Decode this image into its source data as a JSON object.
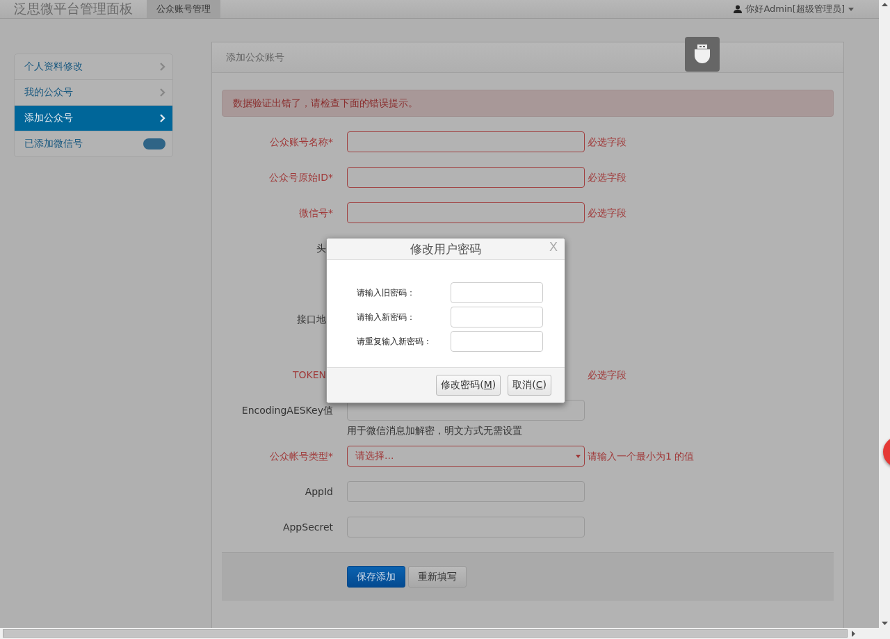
{
  "navbar": {
    "brand": "泛思微平台管理面板",
    "tabs": [
      {
        "label": "公众账号管理",
        "selected": true
      }
    ],
    "user": "你好Admin[超级管理员]"
  },
  "sidebar": {
    "items": [
      {
        "label": "个人资料修改",
        "selected": false,
        "kind": "link"
      },
      {
        "label": "我的公众号",
        "selected": false,
        "kind": "link"
      },
      {
        "label": "添加公众号",
        "selected": true,
        "kind": "link"
      },
      {
        "label": "已添加微信号",
        "selected": false,
        "kind": "badge"
      }
    ]
  },
  "panel": {
    "title": "添加公众账号",
    "alert": "数据验证出错了，请检查下面的错误提示。",
    "fields": [
      {
        "kind": "input",
        "label": "公众账号名称",
        "required_mark": "*",
        "invalid": true,
        "error": "必选字段"
      },
      {
        "kind": "input",
        "label": "公众号原始ID",
        "required_mark": "*",
        "invalid": true,
        "error": "必选字段"
      },
      {
        "kind": "input",
        "label": "微信号",
        "required_mark": "*",
        "invalid": true,
        "error": "必选字段"
      },
      {
        "kind": "covered",
        "label": "头",
        "invalid": false
      },
      {
        "kind": "covered",
        "label": "接口地",
        "invalid": false
      },
      {
        "kind": "covered",
        "label": "TOKEN",
        "invalid": true,
        "error": "必选字段"
      },
      {
        "kind": "input",
        "label": "EncodingAESKey值",
        "invalid": false,
        "help": "用于微信消息加解密，明文方式无需设置"
      },
      {
        "kind": "select",
        "label": "公众帐号类型",
        "required_mark": "*",
        "invalid": true,
        "value": "请选择...",
        "error": "请输入一个最小为1 的值"
      },
      {
        "kind": "input",
        "label": "AppId",
        "invalid": false
      },
      {
        "kind": "input",
        "label": "AppSecret",
        "invalid": false
      }
    ],
    "buttons": [
      {
        "label": "保存添加",
        "kind": "primary"
      },
      {
        "label": "重新填写",
        "kind": "default"
      }
    ]
  },
  "dialog": {
    "title": "修改用户密码",
    "close": "X",
    "fields": [
      {
        "label": "请输入旧密码："
      },
      {
        "label": "请输入新密码："
      },
      {
        "label": "请重复输入新密码："
      }
    ],
    "buttons": [
      {
        "before": "修改密码(",
        "key": "M",
        "after": ")"
      },
      {
        "before": "取消(",
        "key": "C",
        "after": ")"
      }
    ]
  }
}
